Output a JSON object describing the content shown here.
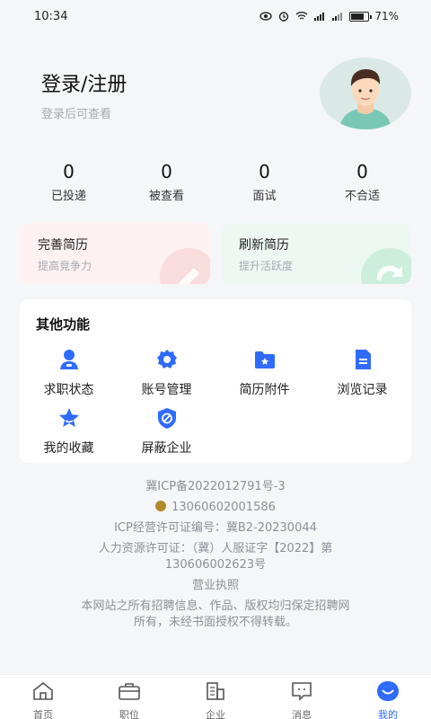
{
  "status": {
    "time": "10:34",
    "battery": "71%"
  },
  "profile": {
    "title": "登录/注册",
    "subtitle": "登录后可查看"
  },
  "stats": [
    {
      "num": "0",
      "label": "已投递"
    },
    {
      "num": "0",
      "label": "被查看"
    },
    {
      "num": "0",
      "label": "面试"
    },
    {
      "num": "0",
      "label": "不合适"
    }
  ],
  "cards": [
    {
      "title": "完善简历",
      "sub": "提高竞争力"
    },
    {
      "title": "刷新简历",
      "sub": "提升活跃度"
    }
  ],
  "functions": {
    "title": "其他功能",
    "items": [
      {
        "label": "求职状态",
        "icon": "person-icon"
      },
      {
        "label": "账号管理",
        "icon": "gear-icon"
      },
      {
        "label": "简历附件",
        "icon": "folder-star-icon"
      },
      {
        "label": "浏览记录",
        "icon": "document-icon"
      },
      {
        "label": "我的收藏",
        "icon": "star-icon"
      },
      {
        "label": "屏蔽企业",
        "icon": "shield-block-icon"
      }
    ]
  },
  "footer": {
    "icp": "冀ICP备2022012791号-3",
    "police": "13060602001586",
    "license": "ICP经营许可证编号：冀B2-20230044",
    "hr_line1": "人力资源许可证：（冀）人服证字【2022】第",
    "hr_line2": "130606002623号",
    "business": "营业执照",
    "copyright1": "本网站之所有招聘信息、作品、版权均归保定招聘网",
    "copyright2": "所有，未经书面授权不得转载。"
  },
  "tabs": [
    {
      "label": "首页"
    },
    {
      "label": "职位"
    },
    {
      "label": "企业"
    },
    {
      "label": "消息"
    },
    {
      "label": "我的"
    }
  ],
  "colors": {
    "accent": "#2f6bff",
    "background": "#f5f6f8"
  }
}
